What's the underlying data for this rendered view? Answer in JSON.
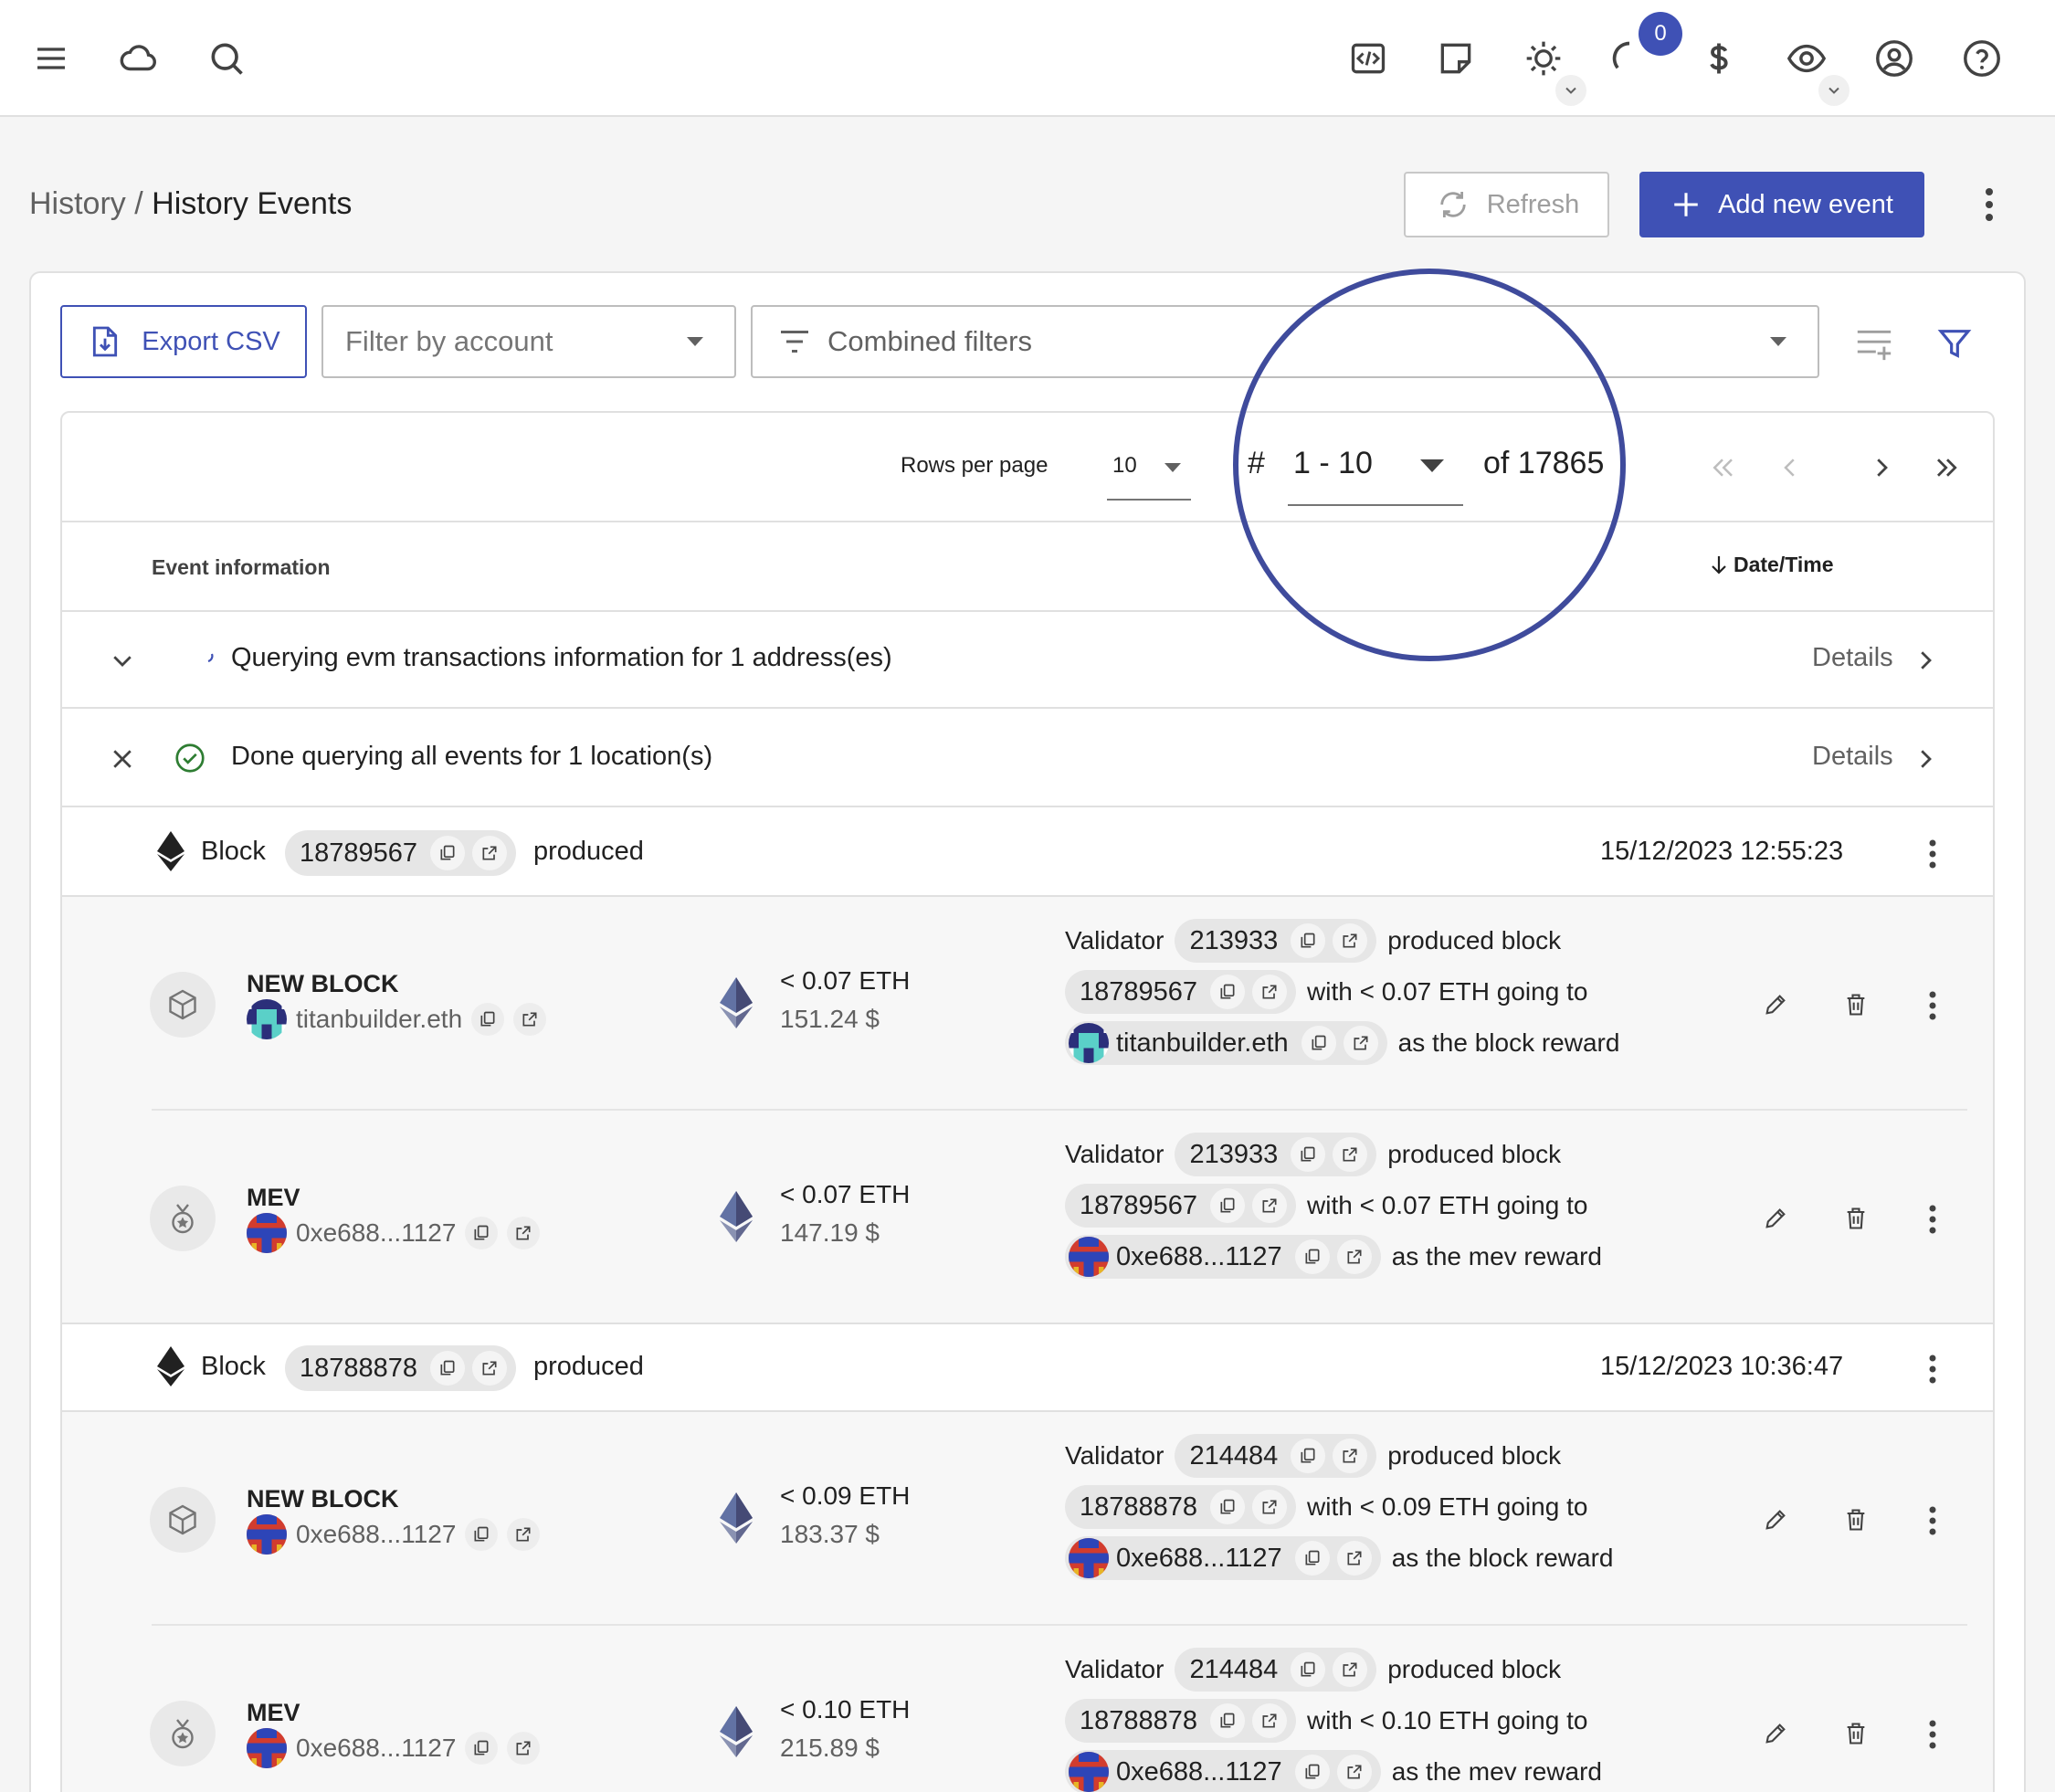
{
  "topbar": {
    "icons": [
      "menu-icon",
      "cloud-icon",
      "search-icon",
      "code-icon",
      "note-icon",
      "theme-icon",
      "progress-icon",
      "currency-icon",
      "privacy-icon",
      "account-icon",
      "help-icon"
    ],
    "notification_count": "0"
  },
  "breadcrumb": {
    "parent": "History",
    "separator": " / ",
    "current": "History Events"
  },
  "actions": {
    "refresh_label": "Refresh",
    "add_label": "Add new event"
  },
  "filters": {
    "export_label": "Export CSV",
    "account_placeholder": "Filter by account",
    "combined_placeholder": "Combined filters"
  },
  "pagination": {
    "rows_per_page_label": "Rows per page",
    "rows_per_page": "10",
    "hash": "#",
    "range": "1 - 10",
    "of_total": "of 17865"
  },
  "columns": {
    "event_info": "Event information",
    "datetime": "Date/Time"
  },
  "status_rows": [
    {
      "text": "Querying evm transactions information for 1 address(es)",
      "details": "Details"
    },
    {
      "text": "Done querying all events for 1 location(s)",
      "details": "Details"
    }
  ],
  "blocks": [
    {
      "label": "Block",
      "number": "18789567",
      "suffix": "produced",
      "datetime": "15/12/2023 12:55:23",
      "events": [
        {
          "type": "NEW BLOCK",
          "account": "titanbuilder.eth",
          "amount": "< 0.07 ETH",
          "value": "151.24 $",
          "validator_label": "Validator",
          "validator": "213933",
          "produced": "produced block",
          "block": "18789567",
          "with_text": "with < 0.07 ETH going to",
          "recipient": "titanbuilder.eth",
          "reward_text": "as the block reward"
        },
        {
          "type": "MEV",
          "account": "0xe688...1127",
          "amount": "< 0.07 ETH",
          "value": "147.19 $",
          "validator_label": "Validator",
          "validator": "213933",
          "produced": "produced block",
          "block": "18789567",
          "with_text": "with < 0.07 ETH going to",
          "recipient": "0xe688...1127",
          "reward_text": "as the mev reward"
        }
      ]
    },
    {
      "label": "Block",
      "number": "18788878",
      "suffix": "produced",
      "datetime": "15/12/2023 10:36:47",
      "events": [
        {
          "type": "NEW BLOCK",
          "account": "0xe688...1127",
          "amount": "< 0.09 ETH",
          "value": "183.37 $",
          "validator_label": "Validator",
          "validator": "214484",
          "produced": "produced block",
          "block": "18788878",
          "with_text": "with < 0.09 ETH going to",
          "recipient": "0xe688...1127",
          "reward_text": "as the block reward"
        },
        {
          "type": "MEV",
          "account": "0xe688...1127",
          "amount": "< 0.10 ETH",
          "value": "215.89 $",
          "validator_label": "Validator",
          "validator": "214484",
          "produced": "produced block",
          "block": "18788878",
          "with_text": "with < 0.10 ETH going to",
          "recipient": "0xe688...1127",
          "reward_text": "as the mev reward"
        }
      ]
    }
  ],
  "colors": {
    "primary": "#3f51b5",
    "success": "#2e7d32",
    "magnifier": "#3f4b9c"
  }
}
